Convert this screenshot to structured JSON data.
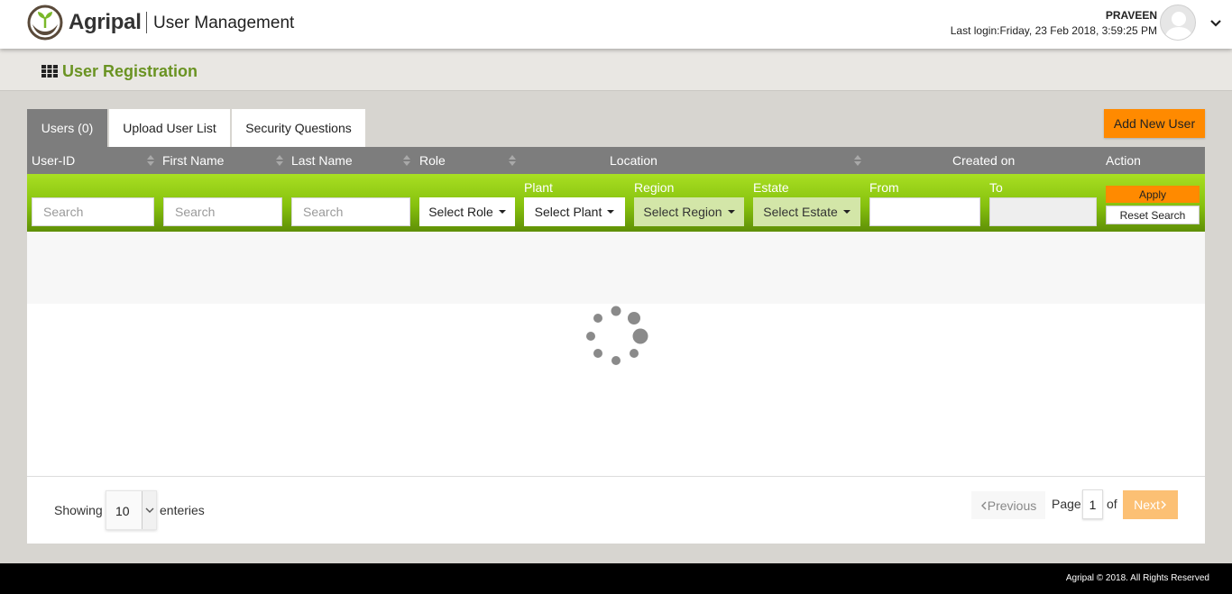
{
  "header": {
    "brand": "Agripal",
    "app_name": "User Management",
    "user_name": "PRAVEEN",
    "last_login": "Last login:Friday, 23 Feb 2018, 3:59:25 PM"
  },
  "page": {
    "title": "User Registration"
  },
  "tabs": [
    {
      "label": "Users (0)",
      "active": true
    },
    {
      "label": "Upload User List",
      "active": false
    },
    {
      "label": "Security Questions",
      "active": false
    }
  ],
  "actions": {
    "add_new_user": "Add New User"
  },
  "table": {
    "columns": [
      "User-ID",
      "First Name",
      "Last Name",
      "Role",
      "Location",
      "Created on",
      "Action"
    ],
    "filters": {
      "user_id_placeholder": "Search",
      "first_name_placeholder": "Search",
      "last_name_placeholder": "Search",
      "role": "Select Role",
      "plant_label": "Plant",
      "plant": "Select Plant",
      "region_label": "Region",
      "region": "Select Region",
      "estate_label": "Estate",
      "estate": "Select Estate",
      "from_label": "From",
      "to_label": "To",
      "apply": "Apply",
      "reset": "Reset Search"
    }
  },
  "pagination": {
    "showing": "Showing",
    "per_page": "10",
    "enteries": "enteries",
    "previous": "Previous",
    "page_label": "Page",
    "page": "1",
    "of_label": "of",
    "next": "Next"
  },
  "footer": {
    "copyright": "Agripal © 2018. All Rights Reserved"
  },
  "colors": {
    "accent_orange": "#ff8a00",
    "brand_green": "#6a9322",
    "filter_green": "#86c10e",
    "header_gray": "#7d7d7d"
  }
}
